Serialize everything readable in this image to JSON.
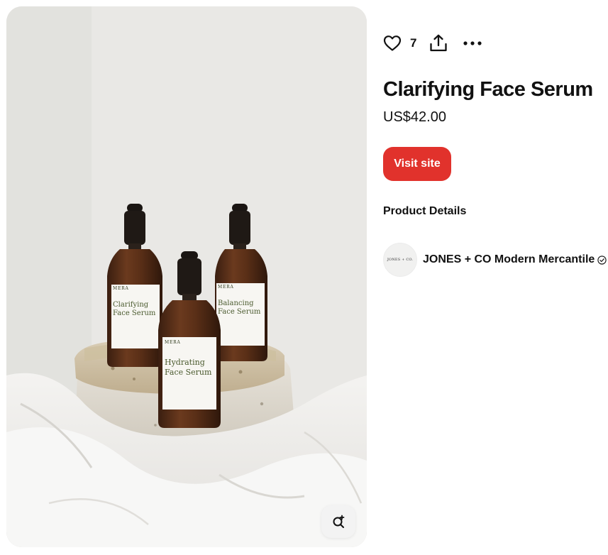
{
  "product": {
    "title": "Clarifying Face Serum",
    "price": "US$42.00",
    "image": {
      "subject": "three amber dropper serum bottles on stone",
      "bottle_labels": [
        {
          "brand": "MERA",
          "line1": "Clarifying",
          "line2": "Face Serum"
        },
        {
          "brand": "MERA",
          "line1": "Balancing",
          "line2": "Face Serum"
        },
        {
          "brand": "MERA",
          "line1": "Hydrating",
          "line2": "Face Serum"
        }
      ]
    }
  },
  "actions": {
    "like_count": "7",
    "like_icon": "heart-icon",
    "share_icon": "share-icon",
    "more_icon": "more-horizontal-icon"
  },
  "visit": {
    "label": "Visit site",
    "color": "#e1322c"
  },
  "details": {
    "heading": "Product Details"
  },
  "merchant": {
    "name": "JONES + CO Modern Mercantile",
    "logo_text": "JONES + CO.",
    "verified_icon": "verified-check-icon"
  },
  "visual_search": {
    "icon": "visual-search-icon"
  }
}
